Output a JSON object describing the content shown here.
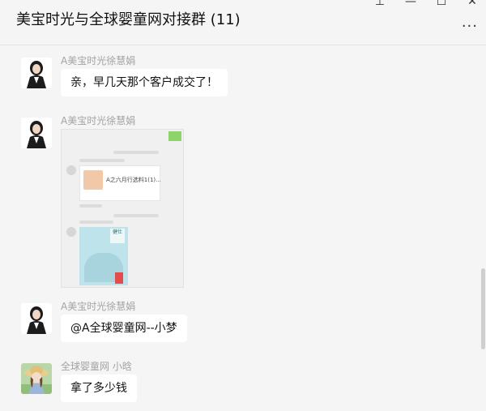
{
  "window": {
    "title": "美宝时光与全球婴童网对接群 (11)",
    "controls": {
      "pin": "⊥",
      "minimize": "—",
      "maximize": "☐",
      "close": "✕"
    },
    "more": "···"
  },
  "messages": [
    {
      "sender": "A美宝时光徐慧娟",
      "text": "亲，早几天那个客户成交了！"
    },
    {
      "sender": "A美宝时光徐慧娟",
      "type": "image",
      "image": {
        "card_text": "A之六月行选料1(1)...",
        "poster_text": "健仕"
      }
    },
    {
      "sender": "A美宝时光徐慧娟",
      "text": "@A全球婴童网--小梦"
    },
    {
      "sender": "全球婴童网  小晗",
      "text": "拿了多少钱"
    }
  ]
}
